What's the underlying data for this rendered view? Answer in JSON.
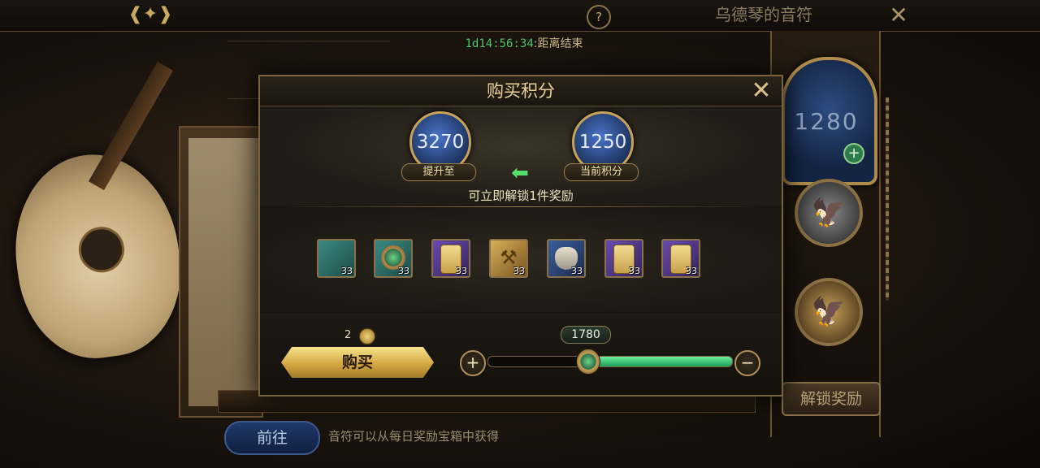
{
  "header": {
    "title": "乌德琴的音符",
    "back_icon": "back-arrow-icon",
    "help_icon": "question-icon",
    "close_icon": "close-x-icon"
  },
  "event": {
    "countdown": "1d14:56:34",
    "countdown_label": ":距离结束"
  },
  "side": {
    "points": "1280",
    "unlock_label": "解锁奖励"
  },
  "footer": {
    "goto_label": "前往",
    "hint": "音符可以从每日奖励宝箱中获得"
  },
  "modal": {
    "title": "购买积分",
    "target_points": "3270",
    "target_label": "提升至",
    "current_points": "1250",
    "current_label": "当前积分",
    "unlock_text": "可立即解锁1件奖励",
    "items": [
      {
        "kind": "partial-teal",
        "qty": "33"
      },
      {
        "kind": "drum",
        "qty": "33"
      },
      {
        "kind": "scroll-purple",
        "qty": "33"
      },
      {
        "kind": "hammer",
        "qty": "33"
      },
      {
        "kind": "bag",
        "qty": "33"
      },
      {
        "kind": "scroll-purple",
        "qty": "33"
      },
      {
        "kind": "scroll-purple",
        "qty": "33"
      }
    ],
    "cost": "2",
    "buy_label": "购买",
    "slider": {
      "value": "1780",
      "fraction": 0.41,
      "plus_icon": "plus-icon",
      "minus_icon": "minus-icon"
    }
  },
  "colors": {
    "accent_gold": "#c9a862",
    "progress_green": "#17a058",
    "countdown_green": "#4fc56a"
  }
}
